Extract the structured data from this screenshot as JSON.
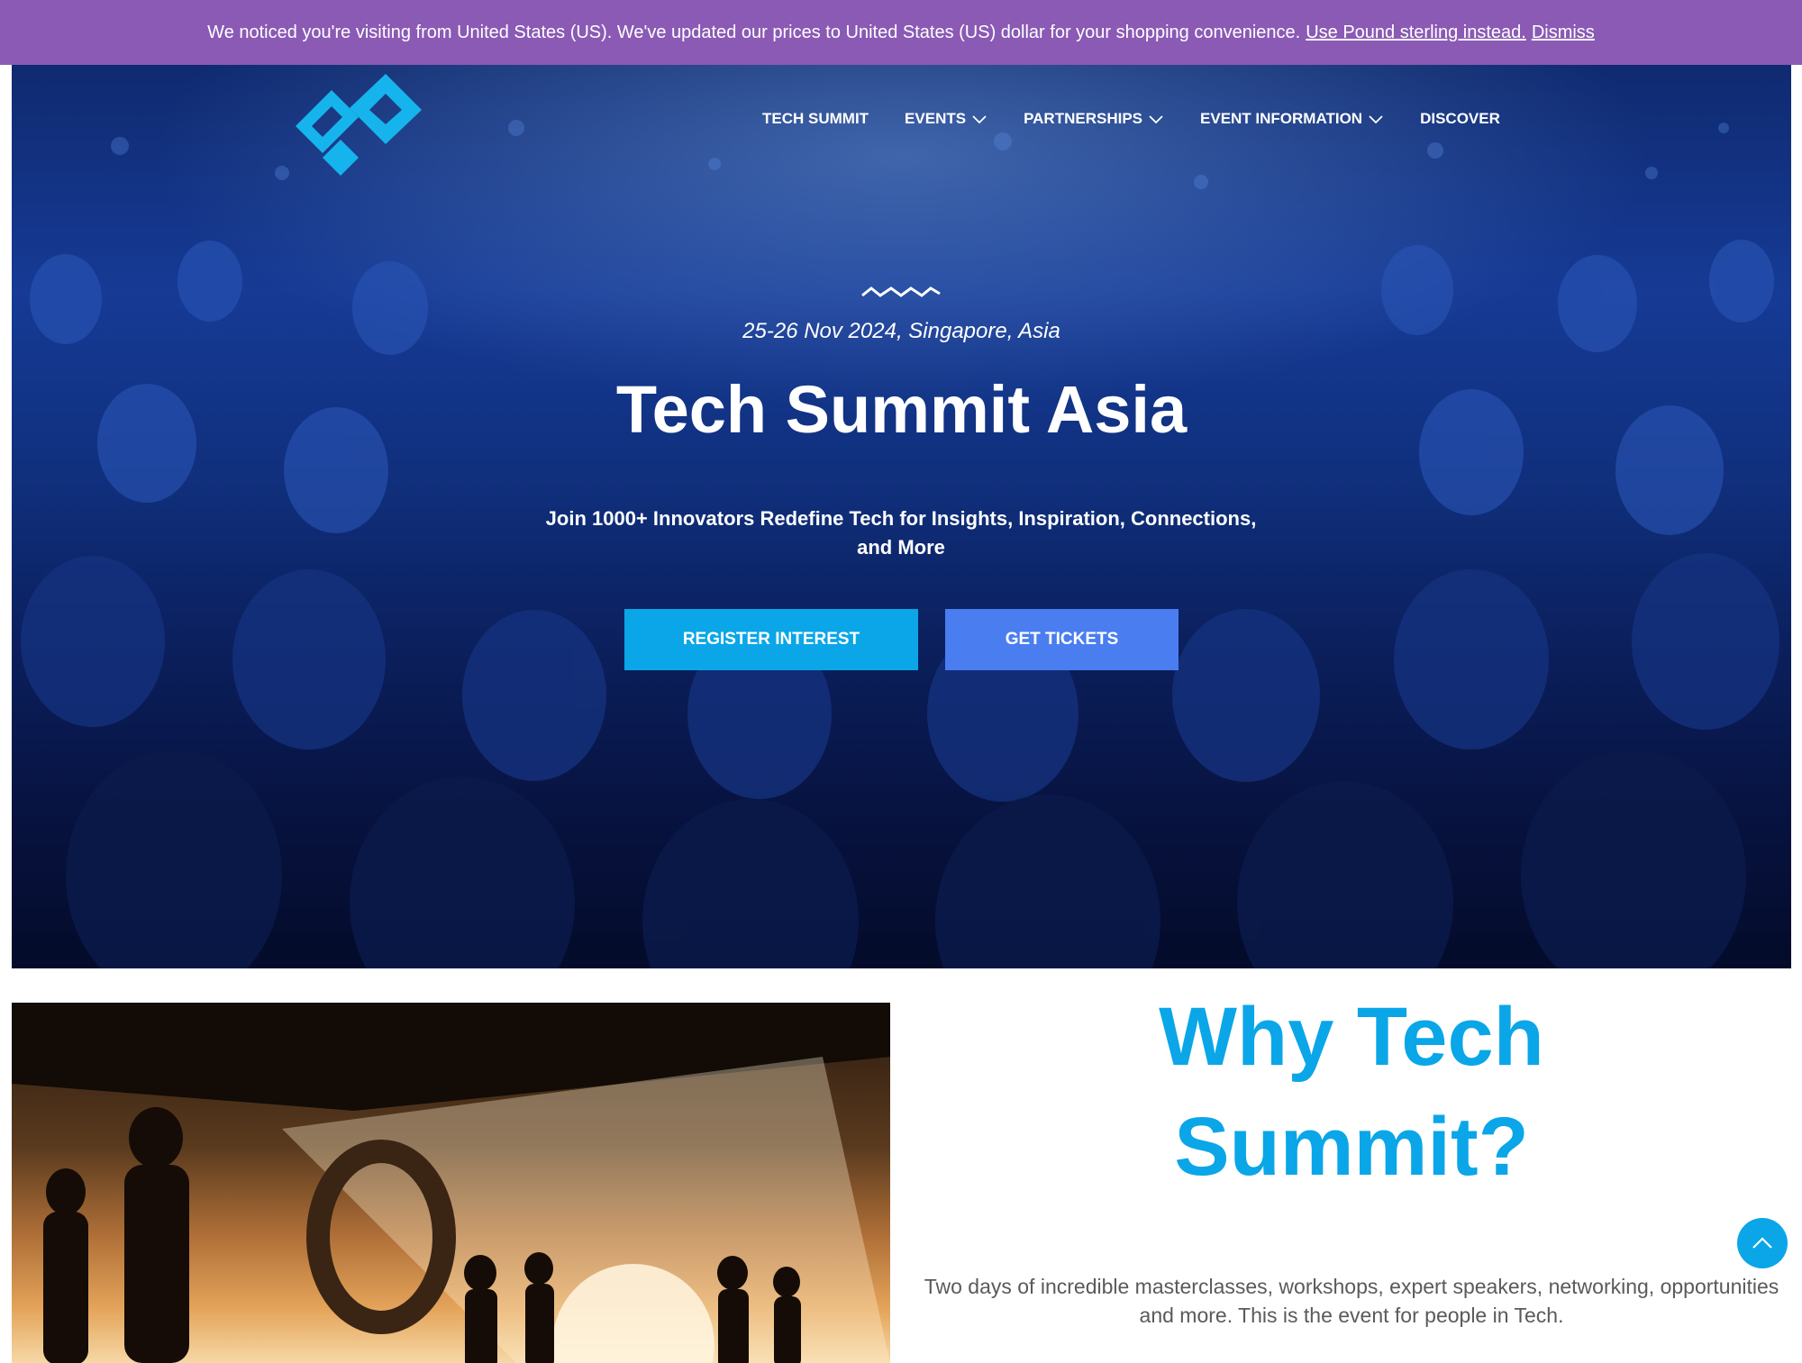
{
  "notice": {
    "message": "We noticed you're visiting from United States (US). We've updated our prices to United States (US) dollar for your shopping convenience.",
    "switch_link": "Use Pound sterling instead.",
    "dismiss_link": "Dismiss"
  },
  "nav": {
    "items": [
      {
        "label": "TECH SUMMIT",
        "dropdown": false
      },
      {
        "label": "EVENTS",
        "dropdown": true
      },
      {
        "label": "PARTNERSHIPS",
        "dropdown": true
      },
      {
        "label": "EVENT INFORMATION",
        "dropdown": true
      },
      {
        "label": "DISCOVER",
        "dropdown": false
      }
    ]
  },
  "hero": {
    "date_location": "25-26 Nov 2024, Singapore, Asia",
    "title": "Tech Summit Asia",
    "subtitle": "Join 1000+ Innovators Redefine Tech for Insights, Inspiration, Connections, and More",
    "register_button": "REGISTER INTEREST",
    "tickets_button": "GET TICKETS"
  },
  "why": {
    "heading_line1": "Why Tech",
    "heading_line2": "Summit?",
    "description": "Two days of incredible masterclasses, workshops, expert speakers, networking, opportunities and more. This is the event for people in Tech."
  },
  "icons": {
    "logo": "brand-logo-icon",
    "chevron": "chevron-down-icon",
    "wave": "wave-divider-icon",
    "scroll_top": "chevron-up-icon"
  },
  "colors": {
    "notice_bg": "#8a5ab5",
    "accent": "#0aa6e8",
    "tickets_button": "#4a7df0",
    "hero_bg": "#163a95",
    "body_text": "#5a5a5a"
  }
}
